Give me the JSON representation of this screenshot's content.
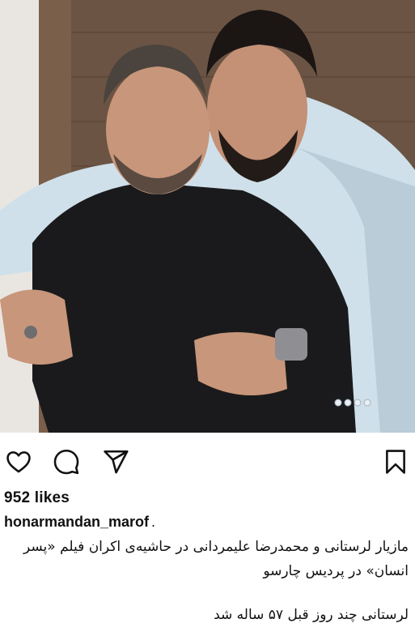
{
  "post": {
    "likes": "952 likes",
    "username": "honarmandan_marof",
    "username_suffix": ".",
    "caption_line1": "مازیار لرستانی و محمدرضا علیمردانی در حاشیه‌ی اکران فیلم «پسر انسان» در پردیس چارسو",
    "caption_line2": "لرستانی چند روز قبل ۵۷ ساله شد"
  },
  "actions": {
    "like_icon": "heart-icon",
    "comment_icon": "comment-icon",
    "share_icon": "send-icon",
    "save_icon": "bookmark-icon"
  },
  "colors": {
    "text": "#111111",
    "background": "#ffffff"
  }
}
